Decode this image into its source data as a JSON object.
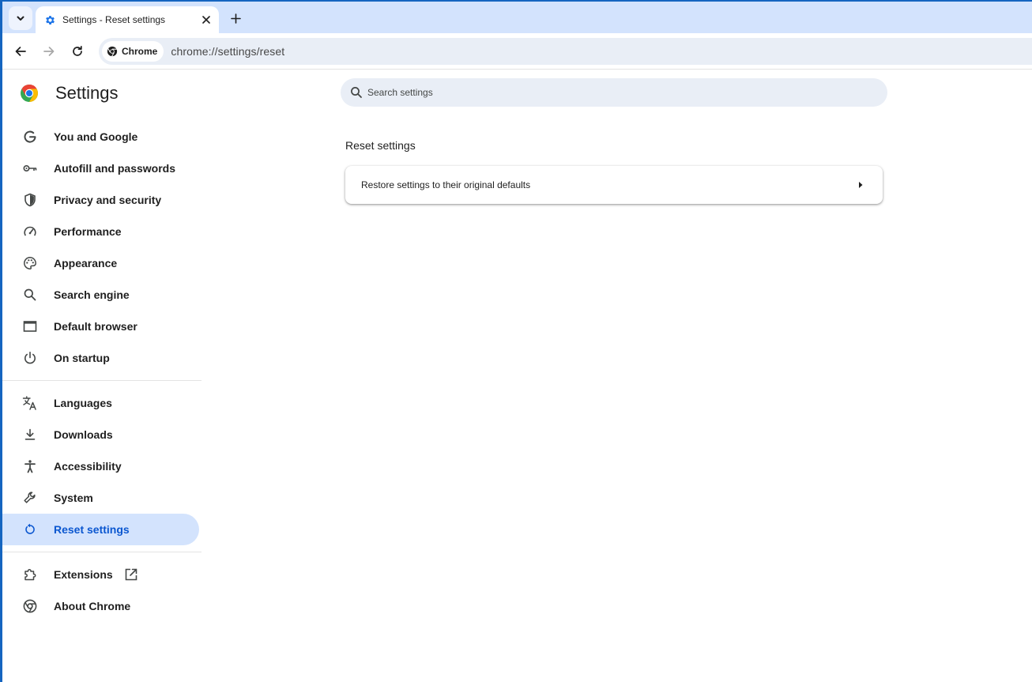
{
  "tab": {
    "title": "Settings - Reset settings"
  },
  "toolbar": {
    "chip_label": "Chrome",
    "url": "chrome://settings/reset"
  },
  "settings": {
    "title": "Settings",
    "search_placeholder": "Search settings",
    "menu": [
      {
        "label": "You and Google",
        "icon": "google-g-icon"
      },
      {
        "label": "Autofill and passwords",
        "icon": "key-icon"
      },
      {
        "label": "Privacy and security",
        "icon": "shield-icon"
      },
      {
        "label": "Performance",
        "icon": "speedometer-icon"
      },
      {
        "label": "Appearance",
        "icon": "palette-icon"
      },
      {
        "label": "Search engine",
        "icon": "search-icon"
      },
      {
        "label": "Default browser",
        "icon": "browser-window-icon"
      },
      {
        "label": "On startup",
        "icon": "power-icon"
      },
      {
        "label": "Languages",
        "icon": "translate-icon"
      },
      {
        "label": "Downloads",
        "icon": "download-icon"
      },
      {
        "label": "Accessibility",
        "icon": "accessibility-icon"
      },
      {
        "label": "System",
        "icon": "wrench-icon"
      },
      {
        "label": "Reset settings",
        "icon": "reset-icon",
        "active": true
      },
      {
        "label": "Extensions",
        "icon": "puzzle-icon"
      },
      {
        "label": "About Chrome",
        "icon": "chrome-logo-icon"
      }
    ],
    "section_title": "Reset settings",
    "restore_label": "Restore settings to their original defaults"
  },
  "colors": {
    "accent": "#0b57d0",
    "active_bg": "#d3e3fd",
    "tabstrip_bg": "#d3e3fd",
    "frame": "#1565c0"
  }
}
